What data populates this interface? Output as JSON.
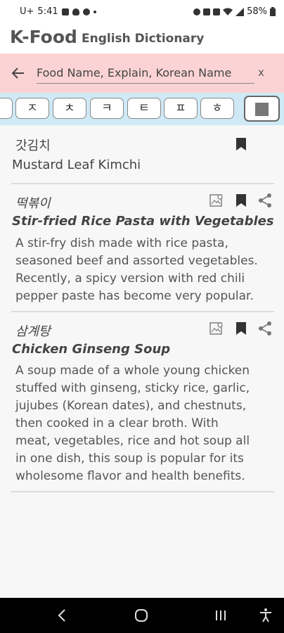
{
  "status": {
    "carrier": "U+",
    "time": "5:41",
    "battery": "58%"
  },
  "app": {
    "title": "K-Food",
    "subtitle": "English Dictionary"
  },
  "search": {
    "placeholder": "Food Name, Explain, Korean Name",
    "clear_label": "x"
  },
  "keys": [
    "ㅅ",
    "ㅈ",
    "ㅊ",
    "ㅋ",
    "ㅌ",
    "ㅍ",
    "ㅎ"
  ],
  "entries": [
    {
      "korean": "갓김치",
      "english": "Mustard Leaf Kimchi",
      "description": ""
    },
    {
      "korean": "떡볶이",
      "english": "Stir-fried Rice Pasta with Vegetables",
      "description_lines": [
        "A stir-fry dish made with rice pasta,",
        "seasoned beef and assorted vegetables.",
        "Recently, a spicy version with red chili",
        "pepper paste has become very popular."
      ]
    },
    {
      "korean": "삼계탕",
      "english": "Chicken Ginseng Soup",
      "description_lines": [
        "A soup made of a whole young chicken",
        "stuffed with ginseng, sticky rice, garlic,",
        "jujubes (Korean dates), and chestnuts,",
        "then cooked in a clear broth. With",
        "meat, vegetables, rice and hot soup all",
        "in one dish, this soup is popular for its",
        "wholesome flavor and health benefits."
      ]
    }
  ]
}
